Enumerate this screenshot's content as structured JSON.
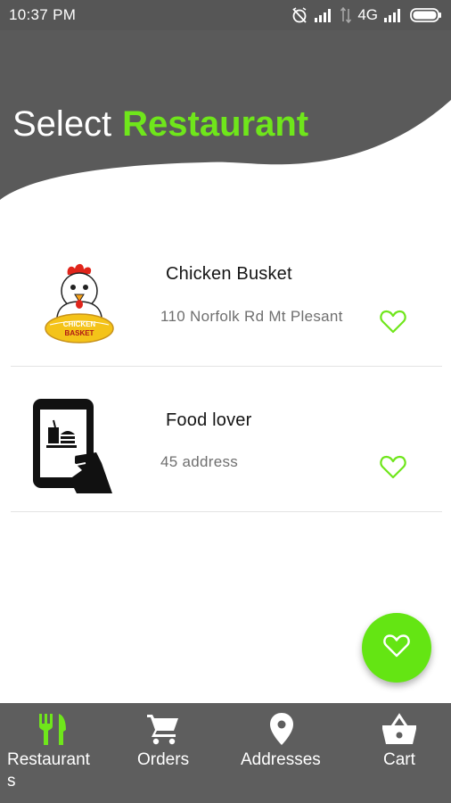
{
  "status_bar": {
    "time": "10:37 PM",
    "network": "4G",
    "icons": [
      "alarm-off-icon",
      "signal-icon",
      "data-arrows-icon",
      "signal-icon",
      "battery-icon"
    ]
  },
  "header": {
    "title_prefix": "Select",
    "title_highlight": "Restaurant"
  },
  "restaurants": [
    {
      "name": "Chicken Busket",
      "address": "110 Norfolk Rd Mt Plesant",
      "logo_text_line1": "CHICKEN",
      "logo_text_line2": "BASKET",
      "icon": "heart-outline-icon"
    },
    {
      "name": "Food lover",
      "address": "45 address",
      "icon": "heart-outline-icon"
    }
  ],
  "fab": {
    "icon": "heart-icon"
  },
  "bottom_nav": {
    "items": [
      {
        "label": "Restaurants",
        "icon": "cutlery-icon",
        "active": true
      },
      {
        "label": "Orders",
        "icon": "shopping-cart-icon",
        "active": false
      },
      {
        "label": "Addresses",
        "icon": "location-pin-icon",
        "active": false
      },
      {
        "label": "Cart",
        "icon": "basket-icon",
        "active": false
      }
    ]
  },
  "colors": {
    "accent": "#6fe61b",
    "fab": "#64e513",
    "header_bg": "#5a5a5a",
    "nav_bg": "#5e5e5e",
    "status_bg": "#565656"
  }
}
